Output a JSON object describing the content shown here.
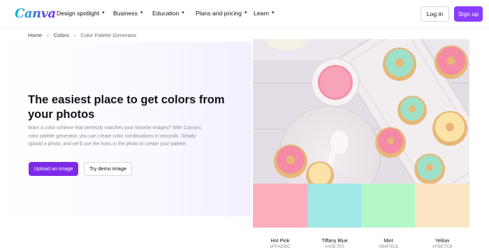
{
  "nav": {
    "logo": "Canva",
    "menu": [
      {
        "label": "Design spotlight"
      },
      {
        "label": "Business"
      },
      {
        "label": "Education"
      },
      {
        "label": "Plans and pricing"
      },
      {
        "label": "Learn"
      }
    ],
    "login_label": "Log in",
    "signup_label": "Sign up"
  },
  "breadcrumb": {
    "items": [
      "Home",
      "Colors",
      "Color Palette Generator"
    ],
    "separator": "›"
  },
  "hero": {
    "headline": "The easiest place to get colors from your photos",
    "description": "Want a color scheme that perfectly matches your favorite images? With Canva’s color palette generator, you can create color combinations in seconds. Simply upload a photo, and we’ll use the hues in the photo to create your palette.",
    "upload_label": "Upload an image",
    "demo_label": "Try demo image"
  },
  "palette": [
    {
      "name": "Hot Pink",
      "hex": "#FFAEBC"
    },
    {
      "name": "Tiffany Blue",
      "hex": "#A0E7E5"
    },
    {
      "name": "Mint",
      "hex": "#B4F8C8"
    },
    {
      "name": "Yellow",
      "hex": "#FBE7C6"
    }
  ],
  "colors": {
    "brand_purple": "#8b3dff",
    "upload_button": "#7d2ae8"
  },
  "icons": {
    "chevron": "chevron-down-icon"
  }
}
